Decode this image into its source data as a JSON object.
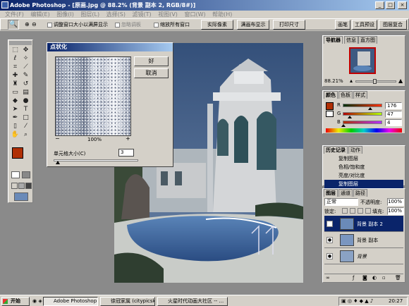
{
  "window": {
    "title": "Adobe Photoshop - [原画.jpg @ 88.2% (背景 副本 2, RGB/8#)]"
  },
  "menu": [
    "文件(F)",
    "编辑(E)",
    "图像(I)",
    "图层(L)",
    "选择(S)",
    "滤镜(T)",
    "视图(V)",
    "窗口(W)",
    "帮助(H)"
  ],
  "options": {
    "resize_label": "调整窗口大小以满屏显示",
    "ignore_palettes": "忽略调板",
    "zoom_all": "缩放所有窗口",
    "actual_pixels": "实际像素",
    "fit_screen": "满画布显示",
    "print_size": "打印尺寸"
  },
  "palette_well": [
    "画笔",
    "工具预设",
    "图层复合"
  ],
  "dialog": {
    "title": "点状化",
    "ok": "好",
    "cancel": "取消",
    "zoom": "100%",
    "cell_size_label": "单元格大小(C)",
    "cell_size_value": "3",
    "cell_fraction": 0.05
  },
  "navigator": {
    "tabs": [
      "导航器",
      "信息",
      "直方图"
    ],
    "zoom": "88.21%",
    "zoom_fraction": 0.47
  },
  "color": {
    "tabs": [
      "颜色",
      "色板",
      "样式"
    ],
    "channels": [
      {
        "label": "R",
        "value": "176",
        "fraction": 0.69
      },
      {
        "label": "G",
        "value": "47",
        "fraction": 0.18
      },
      {
        "label": "B",
        "value": "4",
        "fraction": 0.02
      }
    ],
    "foreground": "#b02f04"
  },
  "history": {
    "tabs": [
      "历史记录",
      "动作"
    ],
    "items": [
      "复制图层",
      "色相/饱和度",
      "亮度/对比度",
      "复制图层"
    ]
  },
  "layers": {
    "tabs": [
      "图层",
      "通道",
      "路径"
    ],
    "blend": "正常",
    "opacity_label": "不透明度:",
    "opacity": "100%",
    "lock_label": "锁定:",
    "fill_label": "填充:",
    "fill": "100%",
    "items": [
      "背景 副本 2",
      "背景 副本",
      "背景"
    ]
  },
  "taskbar": {
    "start": "开始",
    "tasks": [
      "Adobe Photoshop - [原画...",
      "徐冠家属 (citypicsky) -- ...",
      "火星时代动画大社区 -- ..."
    ],
    "clock": "20:27"
  }
}
